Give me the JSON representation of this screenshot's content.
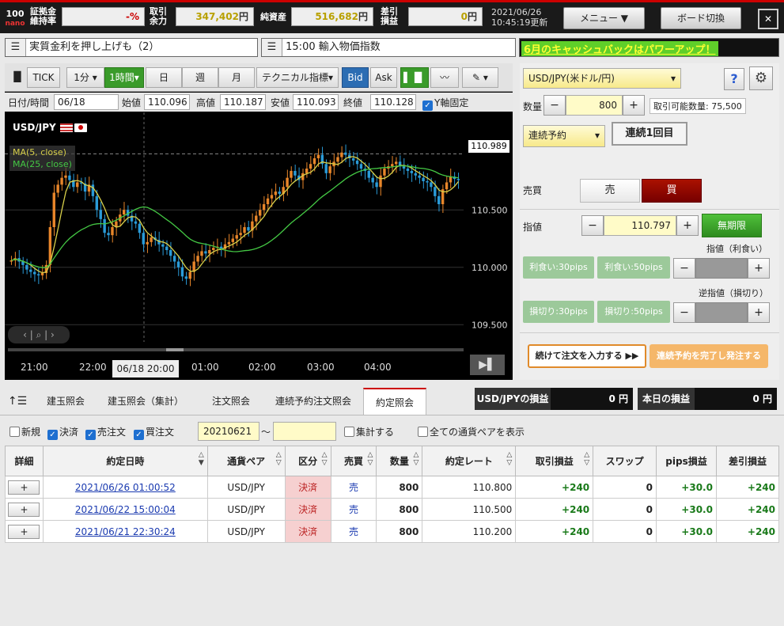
{
  "header": {
    "logo_top": "100",
    "logo_bottom": "nano",
    "margin_label": "証拠金\n維持率",
    "margin_value": "-%",
    "available_label": "取引\n余力",
    "available_value": "347,402",
    "net_assets_label": "純資産",
    "net_assets_value": "516,682",
    "diff_label": "差引\n損益",
    "diff_value": "0",
    "yen": "円",
    "date": "2021/06/26",
    "time": "10:45:19更新",
    "menu_label": "メニュー",
    "board_label": "ボード切換",
    "close_label": "✕"
  },
  "news": {
    "item1": "実質金利を押し上げも（2）",
    "item2": "15:00 輸入物価指数",
    "promo": "6月のキャッシュバックはパワーアップ！"
  },
  "chart_toolbar": {
    "tick": "TICK",
    "min1": "1分",
    "hour1": "1時間",
    "day": "日",
    "week": "週",
    "month": "月",
    "technical": "テクニカル指標",
    "bid": "Bid",
    "ask": "Ask"
  },
  "chart_info": {
    "datetime_label": "日付/時間",
    "datetime_value": "06/18 20:00",
    "open_label": "始値",
    "open_value": "110.096",
    "high_label": "高値",
    "high_value": "110.187",
    "low_label": "安値",
    "low_value": "110.093",
    "close_label": "終値",
    "close_value": "110.128",
    "fix_y_label": "Y軸固定"
  },
  "chart_data": {
    "type": "candlestick",
    "symbol": "USD/JPY",
    "ma5_label": "MA(5, close)",
    "ma25_label": "MA(25, close)",
    "current_price": "110.989",
    "y_ticks": [
      "110.500",
      "110.000",
      "109.500"
    ],
    "ylim": [
      109.35,
      111.35
    ],
    "x_ticks": [
      "21:00",
      "22:00",
      "01:00",
      "02:00",
      "03:00",
      "04:00"
    ],
    "cursor_label": "06/18 20:00",
    "closes": [
      110.06,
      110.08,
      110.05,
      110.02,
      109.98,
      109.96,
      109.94,
      109.93,
      109.95,
      110.02,
      110.35,
      110.65,
      110.72,
      110.78,
      110.8,
      110.76,
      110.7,
      110.74,
      110.73,
      110.66,
      110.72,
      110.62,
      110.5,
      110.42,
      110.3,
      110.28,
      110.35,
      110.4,
      110.46,
      110.5,
      110.45,
      110.4,
      110.38,
      110.3,
      110.2,
      110.22,
      110.26,
      110.24,
      110.2,
      110.18,
      110.15,
      110.1,
      110.05,
      110.0,
      109.92,
      109.9,
      109.96,
      110.05,
      110.1,
      110.14,
      110.12,
      110.15,
      110.17,
      110.18,
      110.16,
      110.2,
      110.22,
      110.25,
      110.28,
      110.3,
      110.35,
      110.32,
      110.4,
      110.45,
      110.5,
      110.55,
      110.6,
      110.63,
      110.66,
      110.64,
      110.7,
      110.78,
      110.84,
      110.8,
      110.76,
      110.82,
      110.86,
      110.9,
      110.95,
      110.98,
      110.9,
      110.82,
      110.88,
      110.92,
      110.96,
      111.0,
      110.98,
      110.95,
      110.93,
      110.9,
      110.86,
      110.84,
      110.78,
      110.74,
      110.7,
      110.8,
      110.86,
      110.88,
      110.9,
      110.92,
      110.88,
      110.86,
      110.84,
      110.82,
      110.8,
      110.78,
      110.75,
      110.74,
      110.7,
      110.62,
      110.55,
      110.68,
      110.74,
      110.79,
      110.77,
      110.76
    ]
  },
  "order": {
    "pair": "USD/JPY(米ドル/円)",
    "qty_label": "数量",
    "qty_value": "800",
    "available_qty": "取引可能数量: 75,500",
    "cont_select": "連続予約",
    "cont_status": "連続1回目",
    "side_label": "売買",
    "sell": "売",
    "buy": "買",
    "price_label": "指値",
    "price_value": "110.797",
    "unlimited": "無期限",
    "tp_label": "指値（利食い）",
    "tp30": "利食い:30pips",
    "tp50": "利食い:50pips",
    "sl_label": "逆指値（損切り）",
    "sl30": "損切り:30pips",
    "sl50": "損切り:50pips",
    "continue_btn": "続けて注文を入力する",
    "submit_btn": "連続予約を完了し発注する",
    "minus": "−",
    "plus": "+"
  },
  "tabs": [
    "建玉照会",
    "建玉照会（集計）",
    "注文照会",
    "連続予約注文照会",
    "約定照会"
  ],
  "pnl": {
    "pair_label": "USD/JPYの損益",
    "pair_value": "0",
    "today_label": "本日の損益",
    "today_value": "0",
    "yen": "円"
  },
  "filters": {
    "new": "新規",
    "close": "決済",
    "sell": "売注文",
    "buy": "買注文",
    "date_from": "20210621",
    "tilde": "〜",
    "aggregate": "集計する",
    "all_pairs": "全ての通貨ペアを表示"
  },
  "table": {
    "headers": [
      "詳細",
      "約定日時",
      "通貨ペア",
      "区分",
      "売買",
      "数量",
      "約定レート",
      "取引損益",
      "スワップ",
      "pips損益",
      "差引損益"
    ],
    "rows": [
      [
        "+",
        "2021/06/26 01:00:52",
        "USD/JPY",
        "決済",
        "売",
        "800",
        "110.800",
        "+240",
        "0",
        "+30.0",
        "+240"
      ],
      [
        "+",
        "2021/06/22 15:00:04",
        "USD/JPY",
        "決済",
        "売",
        "800",
        "110.500",
        "+240",
        "0",
        "+30.0",
        "+240"
      ],
      [
        "+",
        "2021/06/21 22:30:24",
        "USD/JPY",
        "決済",
        "売",
        "800",
        "110.200",
        "+240",
        "0",
        "+30.0",
        "+240"
      ]
    ]
  }
}
